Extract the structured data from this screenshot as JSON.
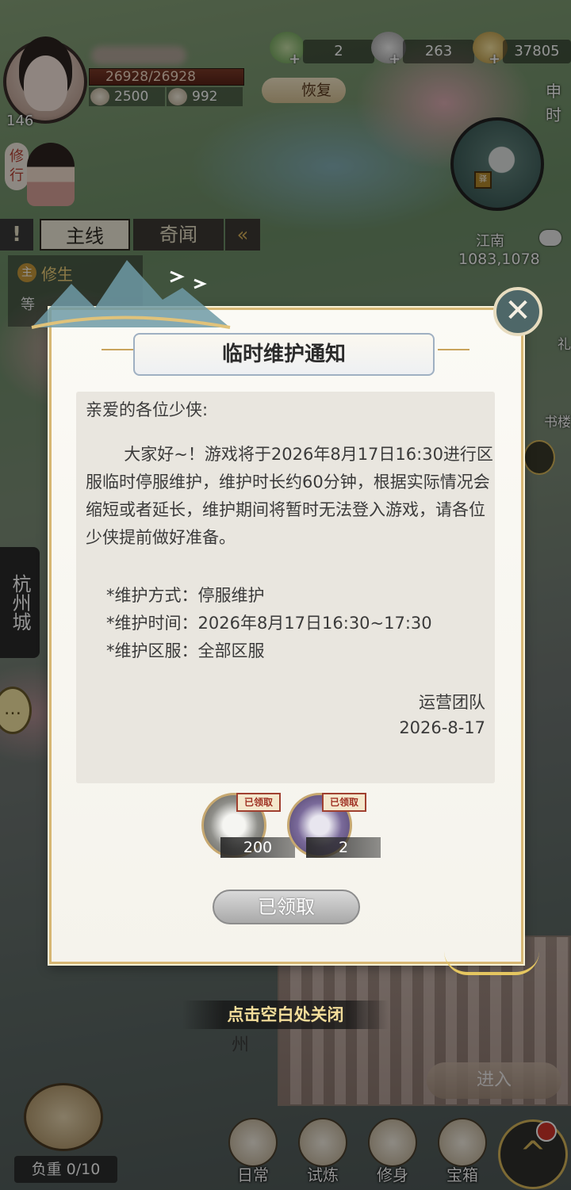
{
  "hud": {
    "level": "146",
    "hp": "26928/26928",
    "stat_left": "2500",
    "stat_right": "992",
    "resources": [
      {
        "name": "jade-icon",
        "value": "2"
      },
      {
        "name": "silver-ingot-icon",
        "value": "263"
      },
      {
        "name": "coin-icon",
        "value": "37805"
      }
    ],
    "recover_label": "恢复",
    "time_label": "申时",
    "cultivate_label": "修行",
    "map_name": "江南",
    "map_coords": "1083,1078",
    "map_marker": "驿"
  },
  "quest": {
    "warn_icon": "!",
    "tab_main": "主线",
    "tab_odd": "奇闻",
    "collapse_icon": "«",
    "badge": "主",
    "title": "修生",
    "sub": "等"
  },
  "side": {
    "city_banner": "杭州城",
    "gift_label": "礼",
    "book_label": "书楼"
  },
  "background": {
    "city_label": "州",
    "enter_label": "进入"
  },
  "bottom": {
    "weight_label": "负重 0/10",
    "buttons": [
      "日常",
      "试炼",
      "修身",
      "宝箱"
    ]
  },
  "dialog": {
    "close_icon": "✕",
    "title": "临时维护通知",
    "greeting": "亲爱的各位少侠:",
    "body": "大家好~！游戏将于2026年8月17日16:30进行区服临时停服维护，维护时长约60分钟，根据实际情况会缩短或者延长，维护期间将暂时无法登入游戏，请各位少侠提前做好准备。",
    "info": [
      "*维护方式：停服维护",
      "*维护时间：2026年8月17日16:30~17:30",
      "*维护区服：全部区服"
    ],
    "signature": "运营团队",
    "date": "2026-8-17",
    "rewards": [
      {
        "icon": "silver-ingot-icon",
        "qty": "200",
        "tag": "已领取"
      },
      {
        "icon": "wine-bottle-icon",
        "qty": "2",
        "tag": "已领取"
      }
    ],
    "claimed_button": "已领取",
    "close_hint": "点击空白处关闭"
  }
}
